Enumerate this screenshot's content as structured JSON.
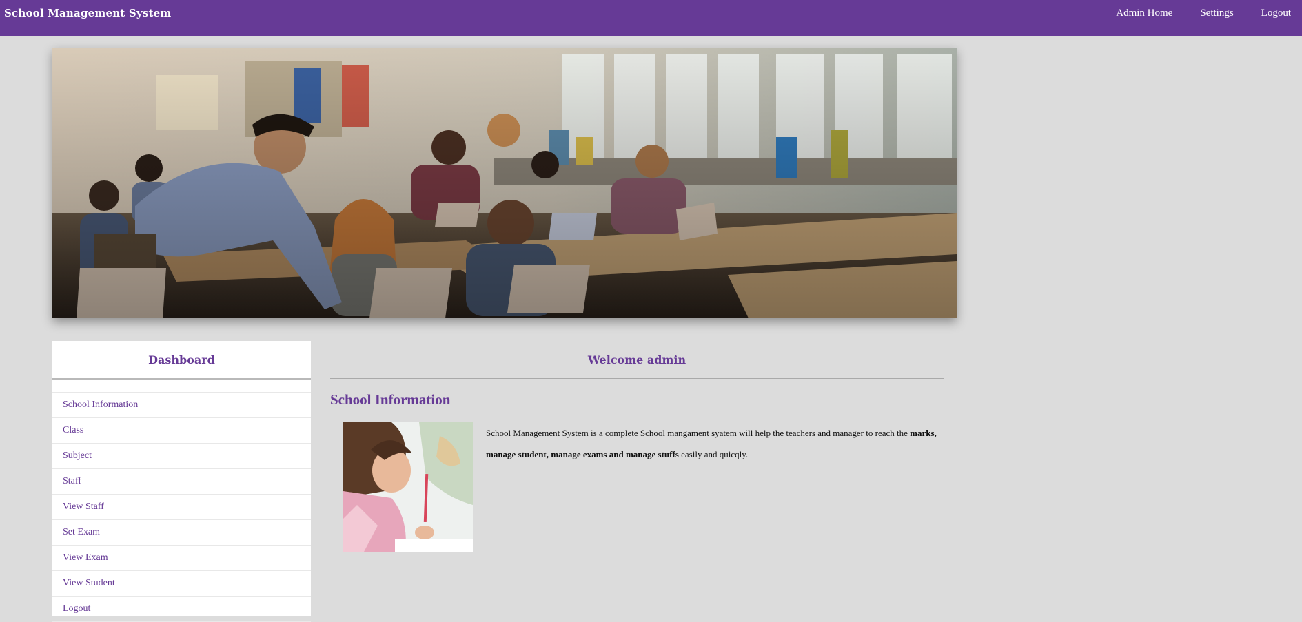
{
  "app": {
    "title": "School Management System"
  },
  "nav": {
    "admin_home": "Admin Home",
    "settings": "Settings",
    "logout": "Logout"
  },
  "sidebar": {
    "title": "Dashboard",
    "items": [
      {
        "label": "School Information"
      },
      {
        "label": "Class"
      },
      {
        "label": "Subject"
      },
      {
        "label": "Staff"
      },
      {
        "label": "View Staff"
      },
      {
        "label": "Set Exam"
      },
      {
        "label": "View Exam"
      },
      {
        "label": "View Student"
      },
      {
        "label": "Logout"
      }
    ]
  },
  "main": {
    "welcome": "Welcome admin",
    "section_title": "School Information",
    "text_part1": "School Management System is a complete School mangament syatem will help the teachers and manager to reach the ",
    "text_bold": "marks, manage student, manage exams and manage stuffs",
    "text_part2": " easily and quicqly."
  },
  "colors": {
    "brand": "#663a96",
    "background": "#dcdcdc"
  }
}
